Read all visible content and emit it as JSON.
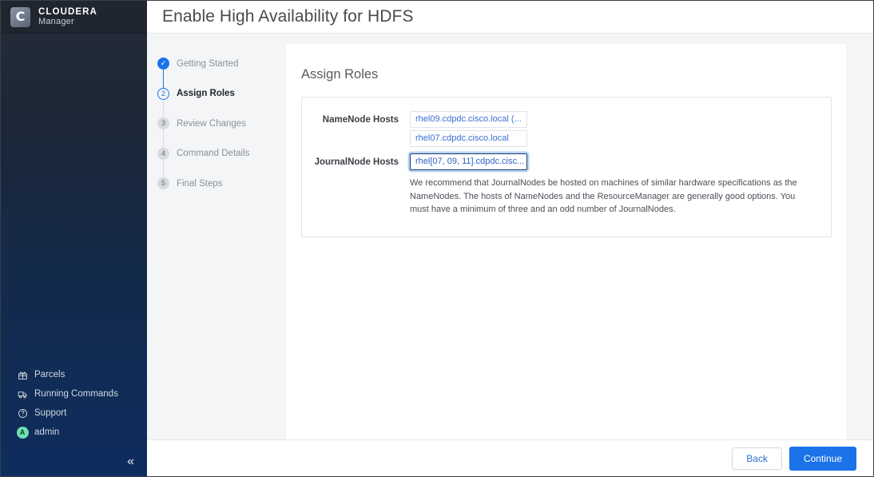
{
  "sidebar": {
    "brand": {
      "logo_letter": "C",
      "line1": "CLOUDERA",
      "line2": "Manager"
    },
    "nav_items": [
      {
        "label": "Parcels",
        "icon": "parcels-icon"
      },
      {
        "label": "Running Commands",
        "icon": "running-commands-icon"
      },
      {
        "label": "Support",
        "icon": "support-icon"
      },
      {
        "label": "admin",
        "icon": "user-avatar-icon",
        "avatar_letter": "A"
      }
    ],
    "collapse_glyph": "«"
  },
  "header": {
    "title": "Enable High Availability for HDFS"
  },
  "wizard": {
    "steps": [
      {
        "number": "1",
        "label": "Getting Started",
        "state": "done",
        "glyph": "✓"
      },
      {
        "number": "2",
        "label": "Assign Roles",
        "state": "current"
      },
      {
        "number": "3",
        "label": "Review Changes",
        "state": "pending"
      },
      {
        "number": "4",
        "label": "Command Details",
        "state": "pending"
      },
      {
        "number": "5",
        "label": "Final Steps",
        "state": "pending"
      }
    ]
  },
  "main": {
    "section_title": "Assign Roles",
    "fields": [
      {
        "label": "NameNode Hosts",
        "values": [
          "rhel09.cdpdc.cisco.local (...",
          "rhel07.cdpdc.cisco.local"
        ]
      },
      {
        "label": "JournalNode Hosts",
        "values": [
          "rhel[07, 09, 11].cdpdc.cisc..."
        ],
        "help": "We recommend that JournalNodes be hosted on machines of similar hardware specifications as the NameNodes. The hosts of NameNodes and the ResourceManager are generally good options. You must have a minimum of three and an odd number of JournalNodes."
      }
    ]
  },
  "footer": {
    "back_label": "Back",
    "continue_label": "Continue"
  },
  "colors": {
    "accent_blue": "#1a73e8",
    "link_blue": "#3c6fd4",
    "sidebar_top": "#252c38",
    "sidebar_bottom": "#0e2d5e",
    "panel_gray": "#f4f5f7",
    "avatar_green": "#6fe0b0"
  }
}
